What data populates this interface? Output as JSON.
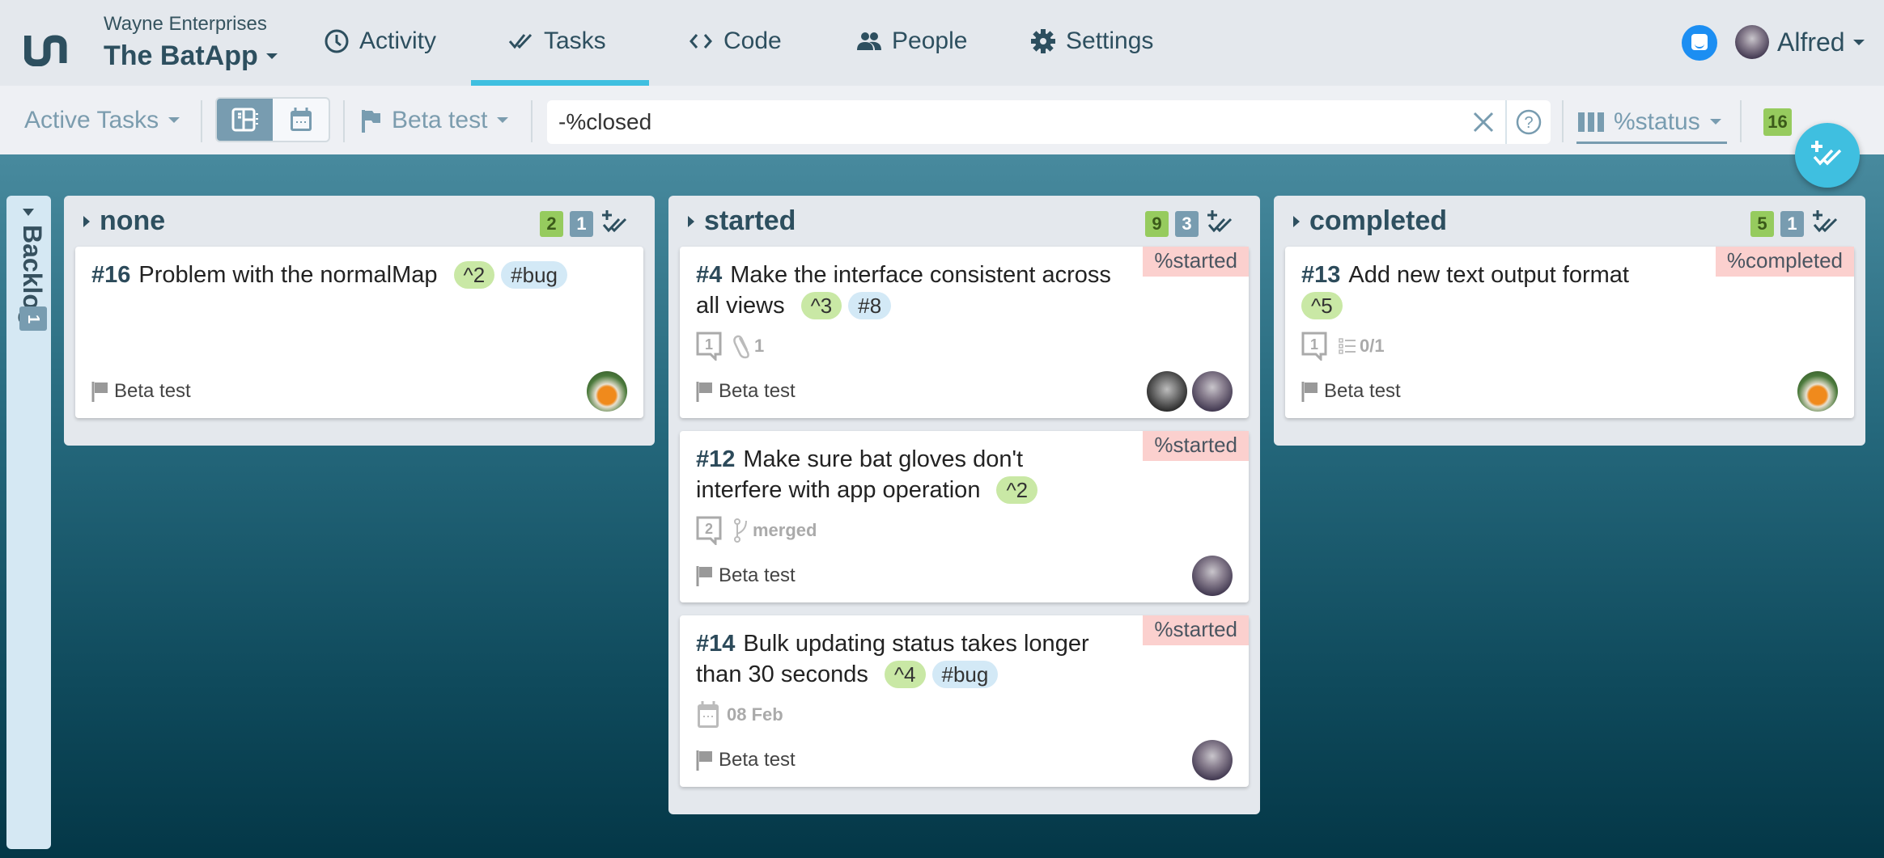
{
  "header": {
    "organization": "Wayne Enterprises",
    "app_name": "The BatApp",
    "nav": [
      {
        "label": "Activity",
        "icon": "clock-icon"
      },
      {
        "label": "Tasks",
        "icon": "double-check-icon",
        "active": true
      },
      {
        "label": "Code",
        "icon": "code-icon"
      },
      {
        "label": "People",
        "icon": "people-icon"
      },
      {
        "label": "Settings",
        "icon": "gear-icon"
      }
    ],
    "user_name": "Alfred"
  },
  "toolbar": {
    "view_filter": "Active Tasks",
    "views": [
      "board-view",
      "calendar-view"
    ],
    "active_view": "board-view",
    "milestone": "Beta test",
    "search_value": "-%closed",
    "group_by": "%status",
    "total_count": "16"
  },
  "colors": {
    "accent": "#3fbfe0",
    "badge_green": "#96cb5e",
    "badge_blue": "#789cb0",
    "status_tag": "#fbd0ce"
  },
  "backlog": {
    "label": "Backlog",
    "count": "1"
  },
  "columns": [
    {
      "title": "none",
      "count_green": "2",
      "count_blue": "1",
      "cards": [
        {
          "id": "#16",
          "title": "Problem with the normalMap",
          "tags": [
            "^2",
            "#bug"
          ],
          "milestone": "Beta test",
          "assignees": [
            "robin"
          ]
        }
      ]
    },
    {
      "title": "started",
      "count_green": "9",
      "count_blue": "3",
      "cards": [
        {
          "id": "#4",
          "title": "Make the interface consistent across all views",
          "tags": [
            "^3",
            "#8"
          ],
          "status": "%started",
          "comments": "1",
          "attachments": "1",
          "milestone": "Beta test",
          "assignees": [
            "dark",
            "alfred"
          ]
        },
        {
          "id": "#12",
          "title": "Make sure bat gloves don't interfere with app operation",
          "tags": [
            "^2"
          ],
          "status": "%started",
          "comments": "2",
          "branch": "merged",
          "milestone": "Beta test",
          "assignees": [
            "alfred"
          ]
        },
        {
          "id": "#14",
          "title": "Bulk updating status takes longer than 30 seconds",
          "tags": [
            "^4",
            "#bug"
          ],
          "status": "%started",
          "due": "08 Feb",
          "milestone": "Beta test",
          "assignees": [
            "alfred"
          ]
        }
      ]
    },
    {
      "title": "completed",
      "count_green": "5",
      "count_blue": "1",
      "cards": [
        {
          "id": "#13",
          "title": "Add new text output format",
          "tags": [
            "^5"
          ],
          "status": "%completed",
          "comments": "1",
          "checklist": "0/1",
          "milestone": "Beta test",
          "assignees": [
            "robin"
          ]
        }
      ]
    }
  ]
}
